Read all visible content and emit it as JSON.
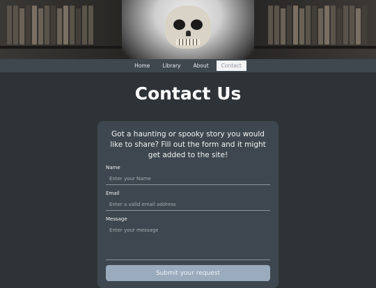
{
  "nav": {
    "items": [
      {
        "label": "Home",
        "active": false
      },
      {
        "label": "Library",
        "active": false
      },
      {
        "label": "About",
        "active": false
      },
      {
        "label": "Contact",
        "active": true
      }
    ]
  },
  "page": {
    "title": "Contact Us",
    "intro": "Got a haunting or spooky story you would like to share? Fill out the form and it might get added to the site!"
  },
  "form": {
    "name": {
      "label": "Name",
      "placeholder": "Enter your Name",
      "value": ""
    },
    "email": {
      "label": "Email",
      "placeholder": "Enter a valid email address",
      "value": ""
    },
    "message": {
      "label": "Message",
      "placeholder": "Enter your message",
      "value": ""
    },
    "submit_label": "Submit your request"
  },
  "colors": {
    "background": "#2e3338",
    "navbar": "#3f474f",
    "card": "#3e474f",
    "button": "#9aabbd"
  }
}
